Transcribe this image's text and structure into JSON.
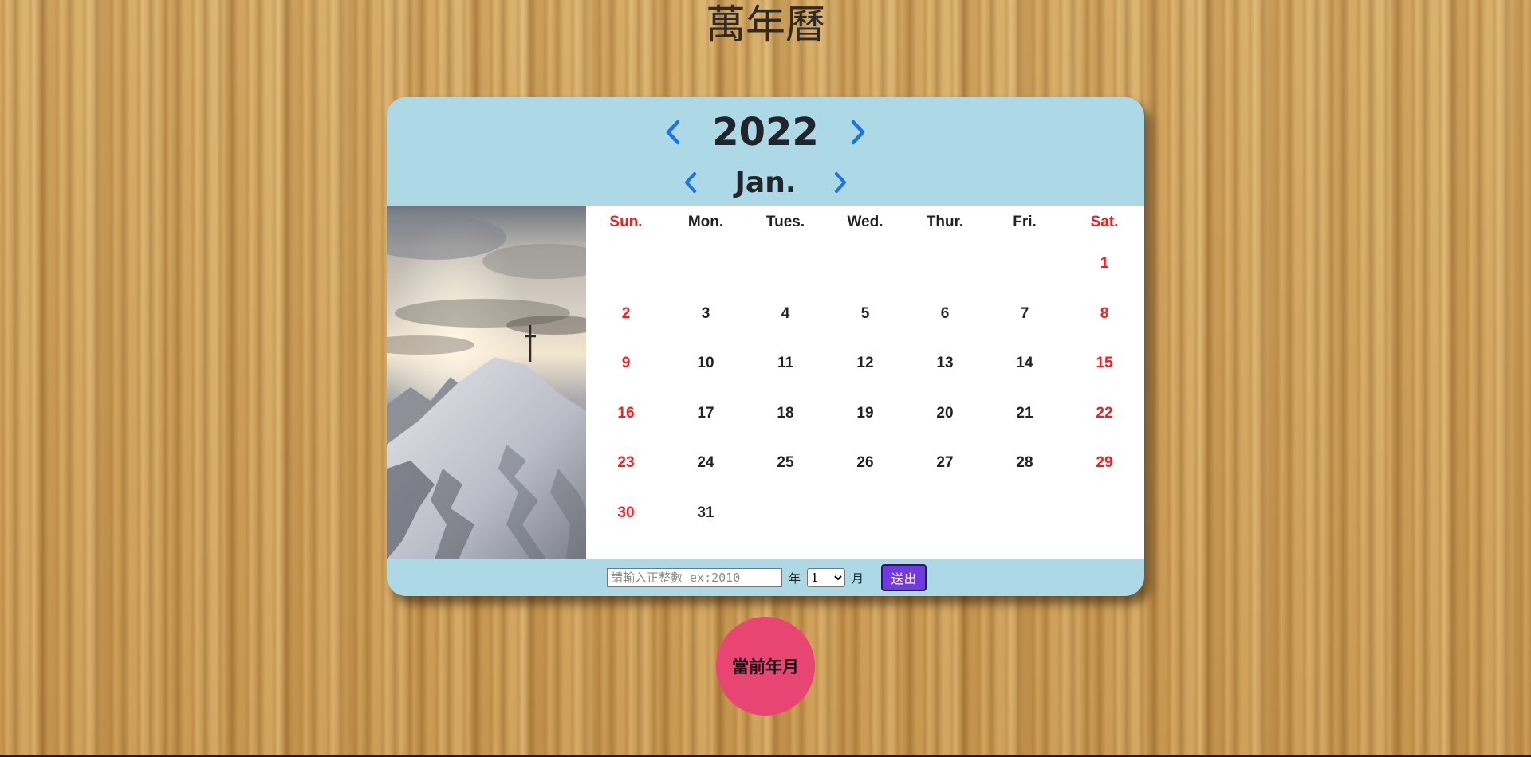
{
  "page": {
    "title": "萬年曆"
  },
  "colors": {
    "header_bg": "#add8e6",
    "arrow": "#1a73e8",
    "weekend": "#ff1a1a",
    "weekday": "#222222",
    "submit_bg": "#6f3ae0",
    "current_btn_bg": "#e84572"
  },
  "header": {
    "year": "2022",
    "month": "Jan.",
    "prev_year_icon": "chevron-left-icon",
    "next_year_icon": "chevron-right-icon",
    "prev_month_icon": "chevron-left-icon",
    "next_month_icon": "chevron-right-icon"
  },
  "photo": {
    "description_icon": "snowy-mountain-summit-cross"
  },
  "weekdays": [
    "Sun.",
    "Mon.",
    "Tues.",
    "Wed.",
    "Thur.",
    "Fri.",
    "Sat."
  ],
  "weeks": [
    [
      "",
      "",
      "",
      "",
      "",
      "",
      "1"
    ],
    [
      "2",
      "3",
      "4",
      "5",
      "6",
      "7",
      "8"
    ],
    [
      "9",
      "10",
      "11",
      "12",
      "13",
      "14",
      "15"
    ],
    [
      "16",
      "17",
      "18",
      "19",
      "20",
      "21",
      "22"
    ],
    [
      "23",
      "24",
      "25",
      "26",
      "27",
      "28",
      "29"
    ],
    [
      "30",
      "31",
      "",
      "",
      "",
      "",
      ""
    ]
  ],
  "footer": {
    "year_input_value": "",
    "year_input_placeholder": "請輸入正整數 ex:2010",
    "year_unit": "年",
    "month_selected": "1",
    "month_unit": "月",
    "submit_label": "送出"
  },
  "current_button": {
    "label": "當前年月"
  }
}
